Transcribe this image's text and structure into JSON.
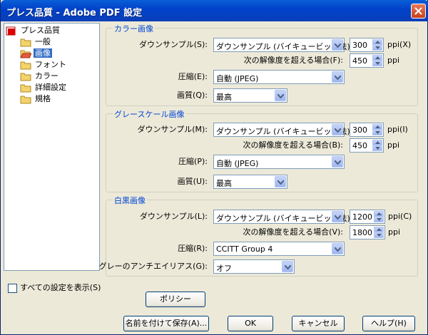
{
  "window": {
    "title": "プレス品質 - Adobe PDF 設定"
  },
  "tree": {
    "root": "プレス品質",
    "items": [
      "一般",
      "画像",
      "フォント",
      "カラー",
      "詳細設定",
      "規格"
    ],
    "selected_index": 1
  },
  "color_section": {
    "title": "カラー画像",
    "downsample_label": "ダウンサンプル(S):",
    "downsample_value": "ダウンサンプル (バイキュービック法)",
    "resolution": "300",
    "resolution_unit": "ppi(X)",
    "threshold_label": "次の解像度を超える場合(F):",
    "threshold": "450",
    "threshold_unit": "ppi",
    "compression_label": "圧縮(E):",
    "compression_value": "自動 (JPEG)",
    "quality_label": "画質(Q):",
    "quality_value": "最高"
  },
  "gray_section": {
    "title": "グレースケール画像",
    "downsample_label": "ダウンサンプル(M):",
    "downsample_value": "ダウンサンプル (バイキュービック法)",
    "resolution": "300",
    "resolution_unit": "ppi(I)",
    "threshold_label": "次の解像度を超える場合(B):",
    "threshold": "450",
    "threshold_unit": "ppi",
    "compression_label": "圧縮(P):",
    "compression_value": "自動 (JPEG)",
    "quality_label": "画質(U):",
    "quality_value": "最高"
  },
  "mono_section": {
    "title": "白黒画像",
    "downsample_label": "ダウンサンプル(L):",
    "downsample_value": "ダウンサンプル (バイキュービック法)",
    "resolution": "1200",
    "resolution_unit": "ppi(C)",
    "threshold_label": "次の解像度を超える場合(V):",
    "threshold": "1800",
    "threshold_unit": "ppi",
    "compression_label": "圧縮(R):",
    "compression_value": "CCITT Group 4",
    "antialias_label": "グレーのアンチエイリアス(G):",
    "antialias_value": "オフ"
  },
  "show_all_label": "すべての設定を表示(S)",
  "buttons": {
    "policy": "ポリシー",
    "save_as": "名前を付けて保存(A)...",
    "ok": "OK",
    "cancel": "キャンセル",
    "help": "ヘルプ(H)"
  },
  "colors": {
    "title_bar": "#0040c8",
    "group_title": "#0046d5",
    "selection": "#316ac5"
  },
  "icons": [
    "close-icon",
    "pdf-settings-icon",
    "folder-icon",
    "folder-open-icon",
    "dropdown-arrow-icon",
    "spin-up-icon",
    "spin-down-icon"
  ]
}
